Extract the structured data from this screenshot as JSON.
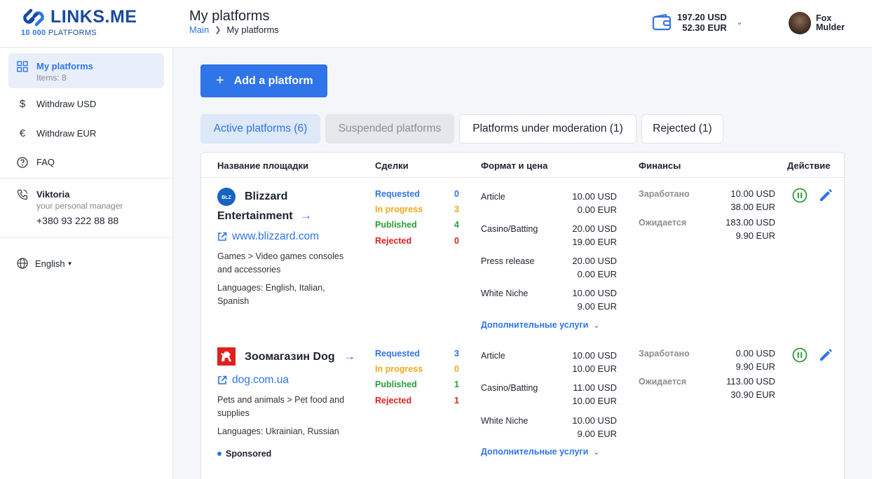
{
  "brand": {
    "name": "LINKS.ME",
    "count": "10 000",
    "count_label": "PLATFORMS",
    "color": "#1a4a9e"
  },
  "header": {
    "title": "My platforms",
    "breadcrumb": {
      "home": "Main",
      "current": "My platforms"
    },
    "balance_usd": "197.20 USD",
    "balance_eur": "52.30 EUR",
    "user_first": "Fox",
    "user_last": "Mulder"
  },
  "sidebar": {
    "items": [
      {
        "label": "My platforms",
        "sub": "Items: 8",
        "icon": "grid-icon",
        "active": true
      },
      {
        "label": "Withdraw USD",
        "icon": "dollar-icon"
      },
      {
        "label": "Withdraw EUR",
        "icon": "euro-icon"
      },
      {
        "label": "FAQ",
        "icon": "question-icon"
      }
    ],
    "manager": {
      "name": "Viktoria",
      "role": "your personal manager",
      "phone": "+380 93 222 88 88"
    },
    "language": "English"
  },
  "actions": {
    "add_platform": "Add a platform"
  },
  "tabs": [
    {
      "label": "Active platforms (6)",
      "state": "active"
    },
    {
      "label": "Suspended platforms",
      "state": "muted"
    },
    {
      "label": "Platforms under moderation (1)",
      "state": "outline"
    },
    {
      "label": "Rejected (1)",
      "state": "outline"
    }
  ],
  "table": {
    "columns": [
      "Название площадки",
      "Сделки",
      "Формат и цена",
      "Финансы",
      "Действие"
    ],
    "deal_labels": {
      "requested": "Requested",
      "in_progress": "In progress",
      "published": "Published",
      "rejected": "Rejected"
    },
    "finance_labels": {
      "earned": "Заработано",
      "expected": "Ожидается"
    },
    "more_services": "Дополнительные услуги",
    "rows": [
      {
        "name_line1": "Blizzard",
        "name_line2": "Entertainment",
        "url": "www.blizzard.com",
        "category_line1": "Games > Video games consoles",
        "category_line2": "and accessories",
        "languages_line1": "Languages: English, Italian,",
        "languages_line2": "Spanish",
        "deals": {
          "requested": "0",
          "in_progress": "3",
          "published": "4",
          "rejected": "0"
        },
        "formats": [
          {
            "name": "Article",
            "usd": "10.00 USD",
            "eur": "0.00 EUR"
          },
          {
            "name": "Casino/Batting",
            "usd": "20.00 USD",
            "eur": "19.00 EUR"
          },
          {
            "name": "Press release",
            "usd": "20.00 USD",
            "eur": "0.00 EUR"
          },
          {
            "name": "White Niche",
            "usd": "10.00 USD",
            "eur": "9.00 EUR"
          }
        ],
        "earned": {
          "usd": "10.00 USD",
          "eur": "38.00 EUR"
        },
        "expected": {
          "usd": "183.00 USD",
          "eur": "9.90 EUR"
        }
      },
      {
        "name": "Зоомагазин Dog",
        "url": "dog.com.ua",
        "category_line1": "Pets and animals > Pet food and",
        "category_line2": "supplies",
        "languages": "Languages: Ukrainian, Russian",
        "badge": "Sponsored",
        "deals": {
          "requested": "3",
          "in_progress": "0",
          "published": "1",
          "rejected": "1"
        },
        "formats": [
          {
            "name": "Article",
            "usd": "10.00 USD",
            "eur": "10.00 EUR"
          },
          {
            "name": "Casino/Batting",
            "usd": "11.00 USD",
            "eur": "10.00 EUR"
          },
          {
            "name": "White Niche",
            "usd": "10.00 USD",
            "eur": "9.00 EUR"
          }
        ],
        "earned": {
          "usd": "0.00 USD",
          "eur": "9.90 EUR"
        },
        "expected": {
          "usd": "113.00 USD",
          "eur": "30.90 EUR"
        }
      }
    ]
  },
  "colors": {
    "accent": "#2f74e8",
    "requested": "#2f74e8",
    "in_progress": "#f0a81c",
    "published": "#2a9d3a",
    "rejected": "#e0201c"
  }
}
